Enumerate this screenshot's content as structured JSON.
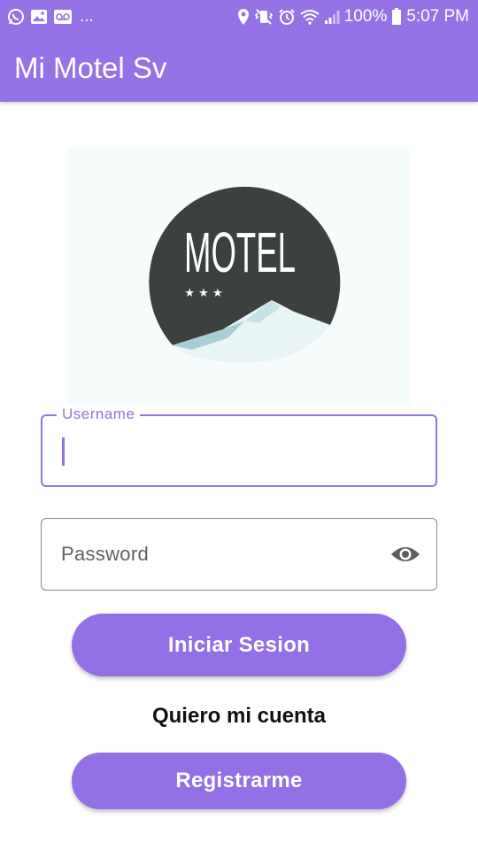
{
  "status_bar": {
    "overflow_indicator": "...",
    "battery_percent": "100%",
    "time": "5:07 PM",
    "icons_left": [
      "whatsapp-icon",
      "gallery-icon",
      "voicemail-icon"
    ],
    "icons_right": [
      "location-icon",
      "vibrate-icon",
      "alarm-icon",
      "wifi-icon",
      "signal-icon",
      "battery-icon"
    ]
  },
  "app_bar": {
    "title": "Mi Motel Sv"
  },
  "logo": {
    "text": "MOTEL",
    "stars": "★ ★ ★"
  },
  "form": {
    "username": {
      "label": "Username",
      "value": ""
    },
    "password": {
      "placeholder": "Password",
      "value": ""
    }
  },
  "actions": {
    "login_label": "Iniciar Sesion",
    "account_prompt": "Quiero mi cuenta",
    "register_label": "Registrarme"
  },
  "colors": {
    "primary": "#9572e6",
    "button": "#9370e5",
    "logo_circle": "#3c4140"
  }
}
